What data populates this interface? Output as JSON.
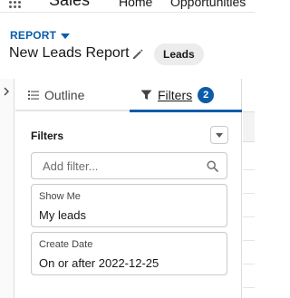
{
  "top_nav": {
    "app_name": "Sales",
    "items": [
      "Home",
      "Opportunities"
    ]
  },
  "header": {
    "report_type_label": "REPORT",
    "report_title": "New Leads Report",
    "report_type_pill": "Leads"
  },
  "panel": {
    "tabs": [
      {
        "label": "Outline",
        "icon": "list-icon",
        "active": false
      },
      {
        "label": "Filters",
        "icon": "filter-icon",
        "active": true,
        "badge": "2"
      }
    ],
    "filters_heading": "Filters",
    "search": {
      "placeholder": "Add filter...",
      "value": ""
    },
    "filters": [
      {
        "label": "Show Me",
        "value": "My leads"
      },
      {
        "label": "Create Date",
        "value": "On or after 2022-12-25"
      }
    ]
  },
  "colors": {
    "accent": "#0b5cab",
    "border": "#c9c9c9",
    "text": "#181818"
  }
}
